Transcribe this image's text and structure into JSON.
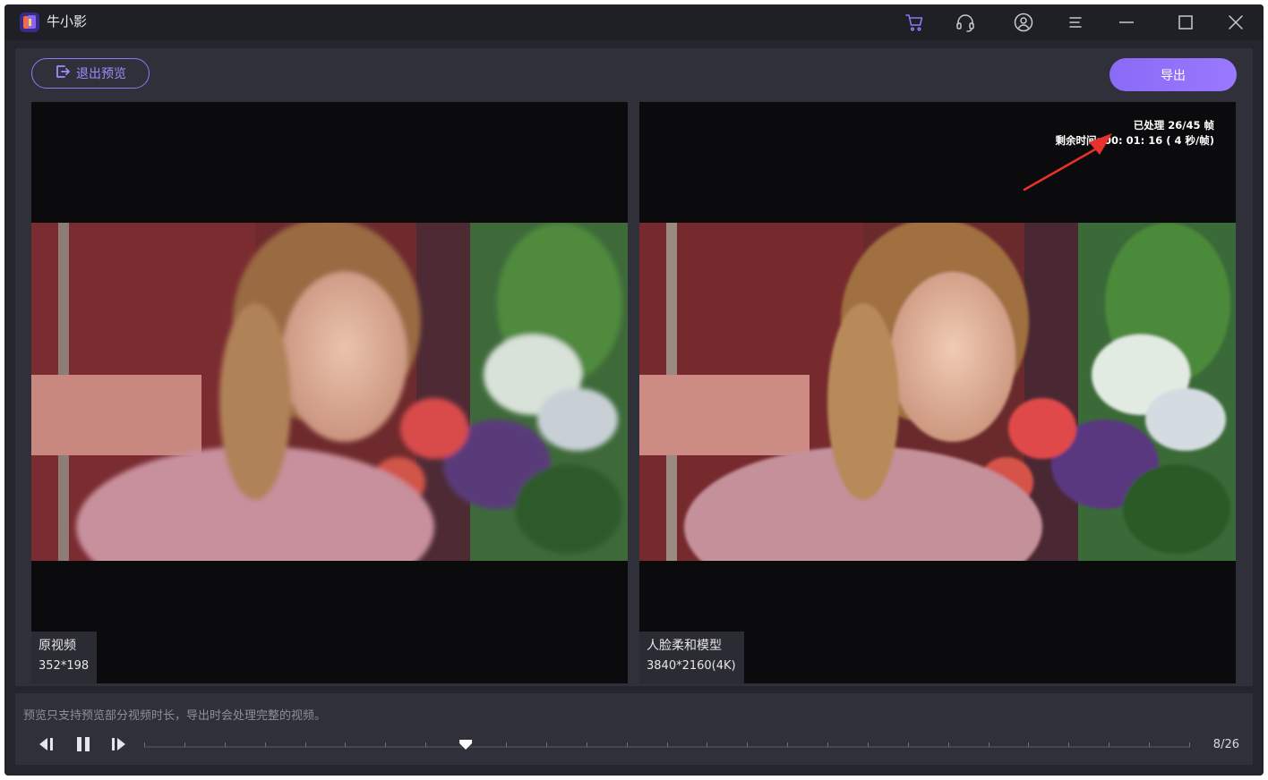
{
  "app": {
    "title": "牛小影"
  },
  "toolbar": {
    "exit_preview_label": "退出预览",
    "export_label": "导出"
  },
  "title_icons": [
    "cart-icon",
    "headset-icon",
    "user-icon",
    "menu-icon",
    "minimize-icon",
    "maximize-icon",
    "close-icon"
  ],
  "left_pane": {
    "label": "原视频",
    "resolution": "352*198"
  },
  "right_pane": {
    "label": "人脸柔和模型",
    "resolution": "3840*2160(4K)",
    "processed": "已处理 26/45 帧",
    "remaining": "剩余时间: 00: 01: 16 ( 4 秒/帧)"
  },
  "player": {
    "hint": "预览只支持预览部分视频时长，导出时会处理完整的视频。",
    "frame_counter": "8/26",
    "current_frame": 8,
    "total_frames": 26
  },
  "colors": {
    "accent": "#8c7af5",
    "background": "#25252d",
    "panel": "#30303a",
    "arrow": "#e8312a"
  }
}
